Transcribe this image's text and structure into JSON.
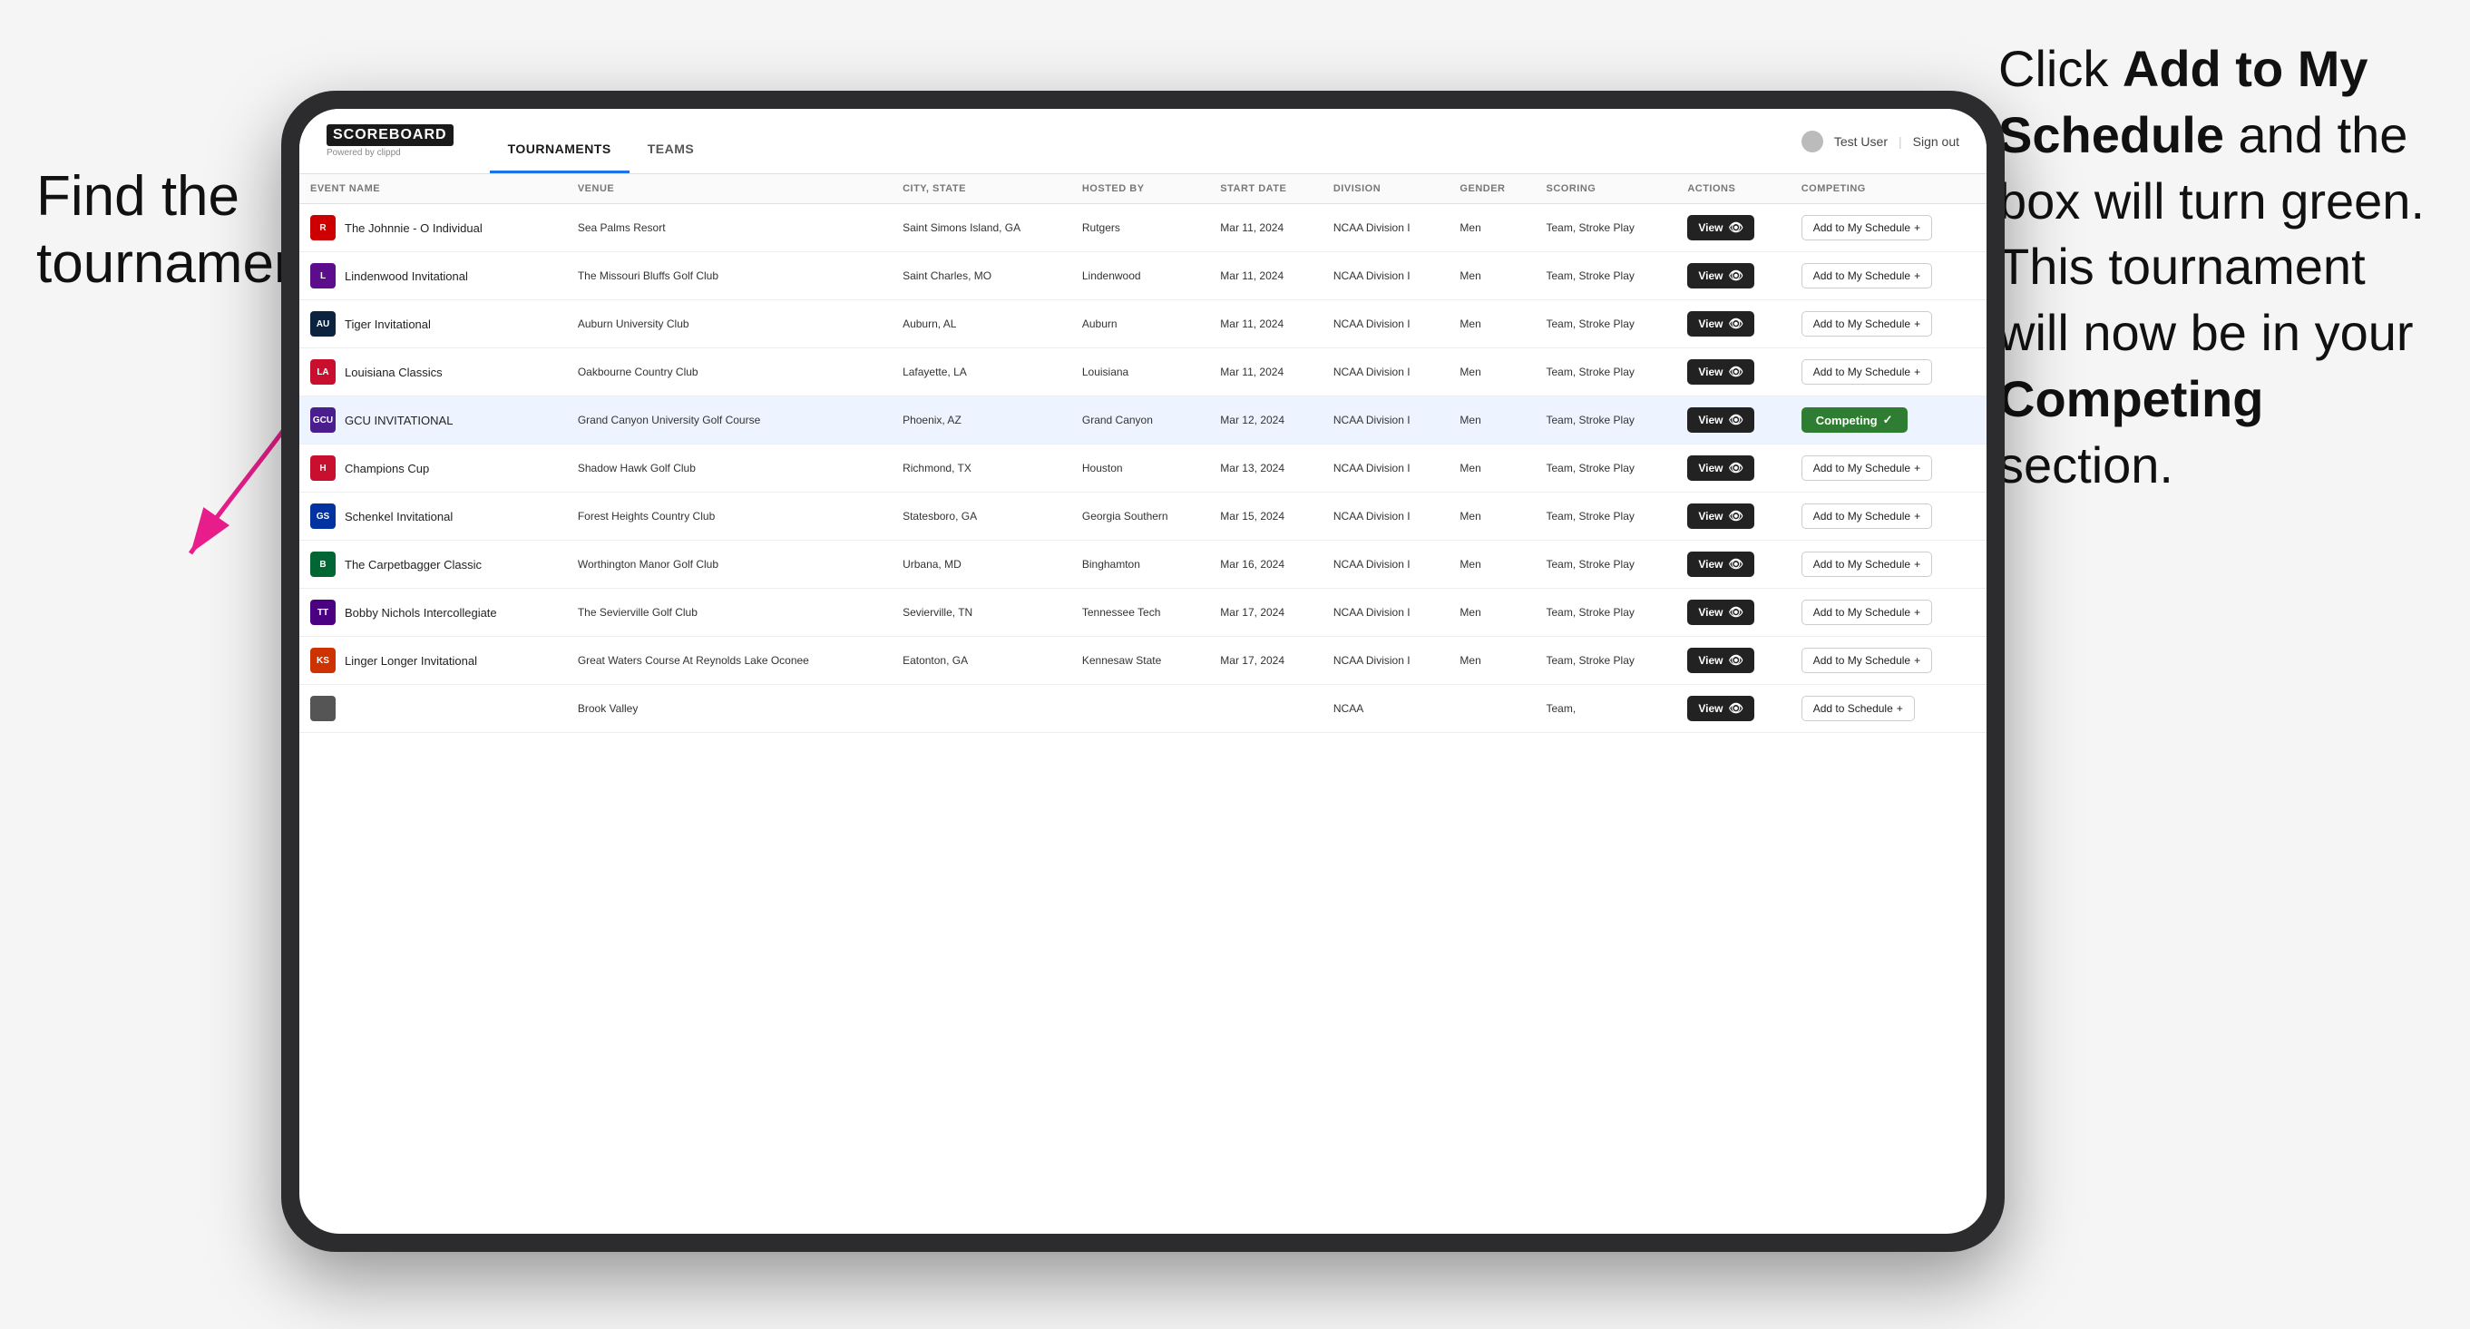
{
  "leftInstruction": {
    "line1": "Find the",
    "line2": "tournament."
  },
  "rightInstruction": {
    "prefix": "Click ",
    "bold1": "Add to My Schedule",
    "middle": " and the box will turn green. This tournament will now be in your ",
    "bold2": "Competing",
    "suffix": " section."
  },
  "app": {
    "logoText": "SCOREBOARD",
    "logoPowered": "Powered by clippd",
    "nav": {
      "tournaments": "TOURNAMENTS",
      "teams": "TEAMS"
    },
    "userLabel": "Test User",
    "signOutLabel": "Sign out",
    "table": {
      "headers": [
        "EVENT NAME",
        "VENUE",
        "CITY, STATE",
        "HOSTED BY",
        "START DATE",
        "DIVISION",
        "GENDER",
        "SCORING",
        "ACTIONS",
        "COMPETING"
      ],
      "rows": [
        {
          "eventName": "The Johnnie - O Individual",
          "logoColor": "#cc0000",
          "logoText": "R",
          "venue": "Sea Palms Resort",
          "cityState": "Saint Simons Island, GA",
          "hostedBy": "Rutgers",
          "startDate": "Mar 11, 2024",
          "division": "NCAA Division I",
          "gender": "Men",
          "scoring": "Team, Stroke Play",
          "actionLabel": "View",
          "competingLabel": "Add to My Schedule",
          "isCompeting": false
        },
        {
          "eventName": "Lindenwood Invitational",
          "logoColor": "#5c0d8c",
          "logoText": "L",
          "venue": "The Missouri Bluffs Golf Club",
          "cityState": "Saint Charles, MO",
          "hostedBy": "Lindenwood",
          "startDate": "Mar 11, 2024",
          "division": "NCAA Division I",
          "gender": "Men",
          "scoring": "Team, Stroke Play",
          "actionLabel": "View",
          "competingLabel": "Add to My Schedule",
          "isCompeting": false
        },
        {
          "eventName": "Tiger Invitational",
          "logoColor": "#0c2340",
          "logoText": "AU",
          "venue": "Auburn University Club",
          "cityState": "Auburn, AL",
          "hostedBy": "Auburn",
          "startDate": "Mar 11, 2024",
          "division": "NCAA Division I",
          "gender": "Men",
          "scoring": "Team, Stroke Play",
          "actionLabel": "View",
          "competingLabel": "Add to My Schedule",
          "isCompeting": false
        },
        {
          "eventName": "Louisiana Classics",
          "logoColor": "#c8102e",
          "logoText": "LA",
          "venue": "Oakbourne Country Club",
          "cityState": "Lafayette, LA",
          "hostedBy": "Louisiana",
          "startDate": "Mar 11, 2024",
          "division": "NCAA Division I",
          "gender": "Men",
          "scoring": "Team, Stroke Play",
          "actionLabel": "View",
          "competingLabel": "Add to My Schedule",
          "isCompeting": false
        },
        {
          "eventName": "GCU INVITATIONAL",
          "logoColor": "#4a1e8c",
          "logoText": "GCU",
          "venue": "Grand Canyon University Golf Course",
          "cityState": "Phoenix, AZ",
          "hostedBy": "Grand Canyon",
          "startDate": "Mar 12, 2024",
          "division": "NCAA Division I",
          "gender": "Men",
          "scoring": "Team, Stroke Play",
          "actionLabel": "View",
          "competingLabel": "Competing",
          "isCompeting": true
        },
        {
          "eventName": "Champions Cup",
          "logoColor": "#c8102e",
          "logoText": "H",
          "venue": "Shadow Hawk Golf Club",
          "cityState": "Richmond, TX",
          "hostedBy": "Houston",
          "startDate": "Mar 13, 2024",
          "division": "NCAA Division I",
          "gender": "Men",
          "scoring": "Team, Stroke Play",
          "actionLabel": "View",
          "competingLabel": "Add to My Schedule",
          "isCompeting": false
        },
        {
          "eventName": "Schenkel Invitational",
          "logoColor": "#0033a0",
          "logoText": "GS",
          "venue": "Forest Heights Country Club",
          "cityState": "Statesboro, GA",
          "hostedBy": "Georgia Southern",
          "startDate": "Mar 15, 2024",
          "division": "NCAA Division I",
          "gender": "Men",
          "scoring": "Team, Stroke Play",
          "actionLabel": "View",
          "competingLabel": "Add to My Schedule",
          "isCompeting": false
        },
        {
          "eventName": "The Carpetbagger Classic",
          "logoColor": "#006633",
          "logoText": "B",
          "venue": "Worthington Manor Golf Club",
          "cityState": "Urbana, MD",
          "hostedBy": "Binghamton",
          "startDate": "Mar 16, 2024",
          "division": "NCAA Division I",
          "gender": "Men",
          "scoring": "Team, Stroke Play",
          "actionLabel": "View",
          "competingLabel": "Add to My Schedule",
          "isCompeting": false
        },
        {
          "eventName": "Bobby Nichols Intercollegiate",
          "logoColor": "#4b0082",
          "logoText": "TT",
          "venue": "The Sevierville Golf Club",
          "cityState": "Sevierville, TN",
          "hostedBy": "Tennessee Tech",
          "startDate": "Mar 17, 2024",
          "division": "NCAA Division I",
          "gender": "Men",
          "scoring": "Team, Stroke Play",
          "actionLabel": "View",
          "competingLabel": "Add to My Schedule",
          "isCompeting": false
        },
        {
          "eventName": "Linger Longer Invitational",
          "logoColor": "#cc3300",
          "logoText": "KS",
          "venue": "Great Waters Course At Reynolds Lake Oconee",
          "cityState": "Eatonton, GA",
          "hostedBy": "Kennesaw State",
          "startDate": "Mar 17, 2024",
          "division": "NCAA Division I",
          "gender": "Men",
          "scoring": "Team, Stroke Play",
          "actionLabel": "View",
          "competingLabel": "Add to My Schedule",
          "isCompeting": false
        },
        {
          "eventName": "",
          "logoColor": "#555",
          "logoText": "",
          "venue": "Brook Valley",
          "cityState": "",
          "hostedBy": "",
          "startDate": "",
          "division": "NCAA",
          "gender": "",
          "scoring": "Team,",
          "actionLabel": "View",
          "competingLabel": "Add to Schedule",
          "isCompeting": false
        }
      ]
    }
  }
}
